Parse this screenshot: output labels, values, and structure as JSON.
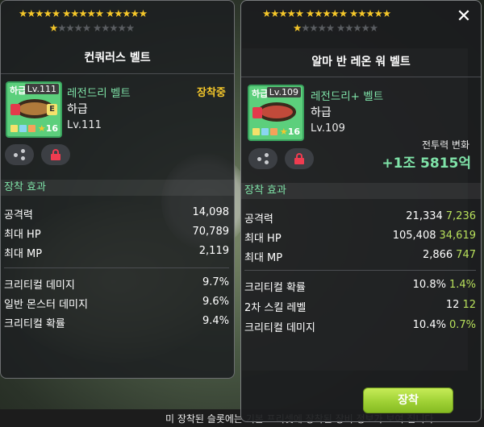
{
  "background": {
    "bottom_bar_text": "미 장착된 슬롯에는 기본 프리셋에 장착된 장비 정보가 보여 집니다"
  },
  "left_panel": {
    "stars_row1": "★★★★★  ★★★★★  ★★★★★",
    "stars_row2_on": "★",
    "stars_row2_off": "★★★★  ★★★★★",
    "title": "컨쿼러스 벨트",
    "icon": {
      "grade": "하급",
      "level_tag": "Lv.111",
      "star_count": "16"
    },
    "item_name": "레전드리 벨트",
    "equipped_label": "장착중",
    "grade_text": "하급",
    "level": "Lv.111",
    "section_title": "장착 효과",
    "stats": [
      {
        "label": "공격력",
        "value": "14,098"
      },
      {
        "label": "최대 HP",
        "value": "70,789"
      },
      {
        "label": "최대 MP",
        "value": "2,119"
      },
      {
        "label": "크리티컬 데미지",
        "value": "9.7%"
      },
      {
        "label": "일반 몬스터 데미지",
        "value": "9.6%"
      },
      {
        "label": "크리티컬 확률",
        "value": "9.4%"
      }
    ]
  },
  "right_panel": {
    "stars_row1": "★★★★★  ★★★★★  ★★★★★",
    "stars_row2_on": "★",
    "stars_row2_off": "★★★★  ★★★★★",
    "title": "알마 반 레온 워 벨트",
    "close_icon": "✕",
    "icon": {
      "grade": "하급",
      "level_tag": "Lv.109",
      "star_count": "16"
    },
    "item_name": "레전드리+ 벨트",
    "grade_text": "하급",
    "level": "Lv.109",
    "power_change_label": "전투력 변화",
    "power_change_value": "+1조 5815억",
    "section_title": "장착 효과",
    "stats": [
      {
        "label": "공격력",
        "value": "21,334",
        "diff": "7,236"
      },
      {
        "label": "최대 HP",
        "value": "105,408",
        "diff": "34,619"
      },
      {
        "label": "최대 MP",
        "value": "2,866",
        "diff": "747"
      },
      {
        "label": "크리티컬 확률",
        "value": "10.8%",
        "diff": "1.4%"
      },
      {
        "label": "2차 스킬 레벨",
        "value": "12",
        "diff": "12"
      },
      {
        "label": "크리티컬 데미지",
        "value": "10.4%",
        "diff": "0.7%"
      }
    ],
    "equip_button": "장착"
  },
  "colors": {
    "accent_green": "#7fe3a8",
    "diff_green": "#b8e05b",
    "star_gold": "#f5c72a",
    "lock_red": "#ef3c50",
    "button_green": "#9fd135"
  }
}
